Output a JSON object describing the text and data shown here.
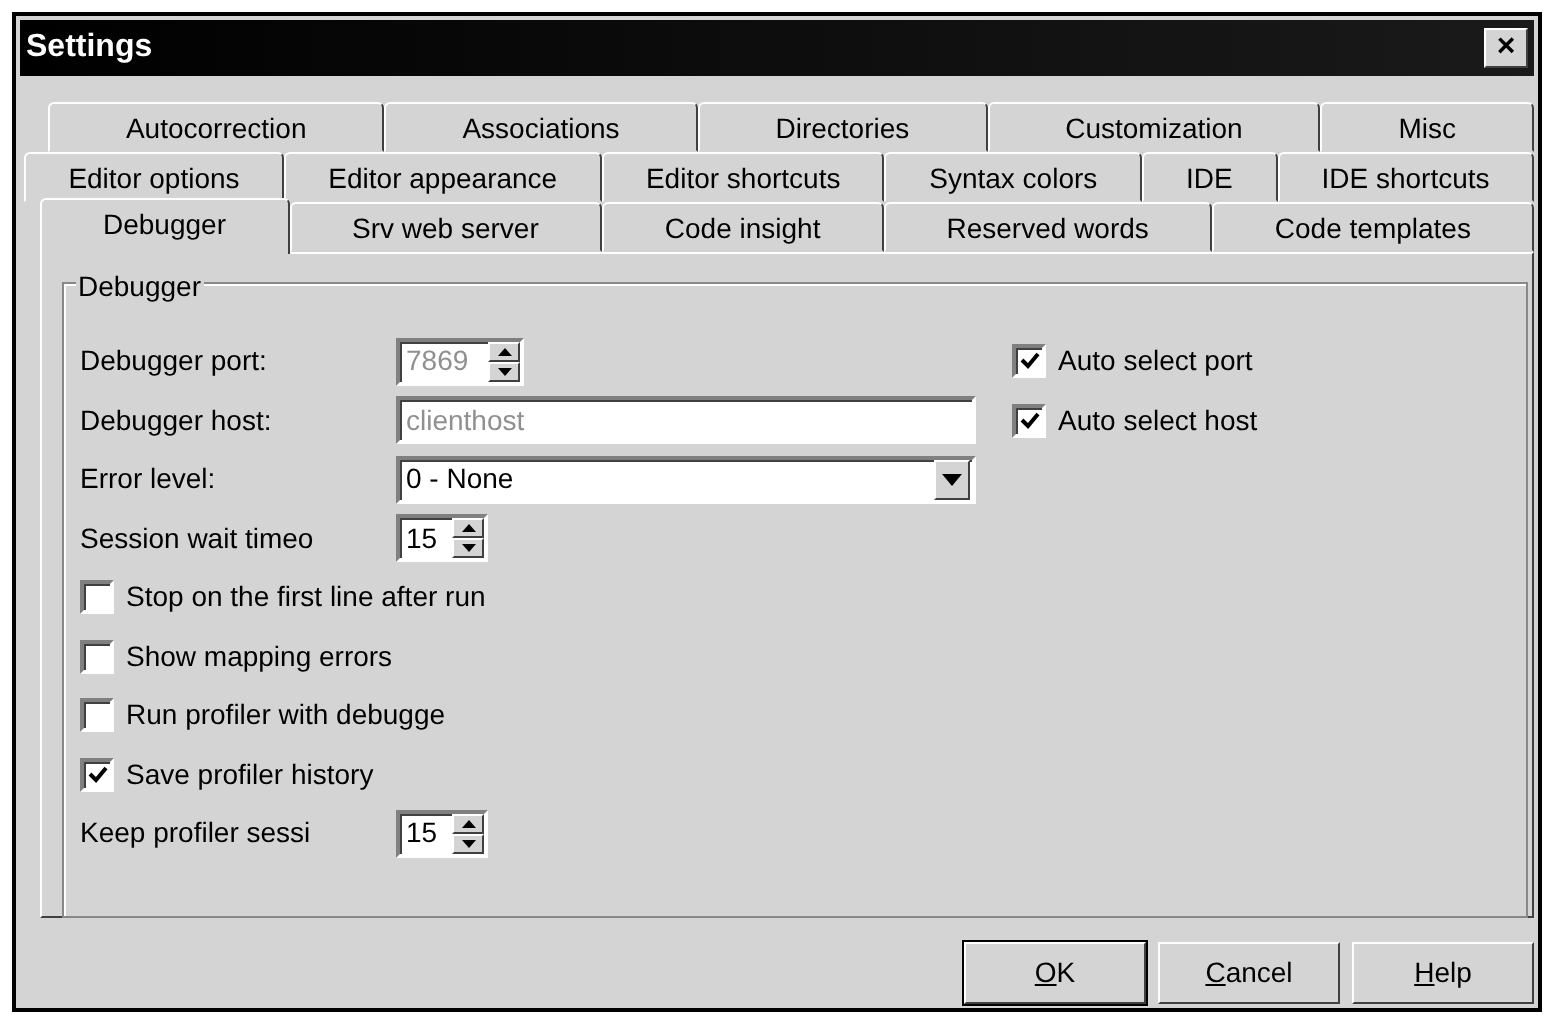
{
  "window": {
    "title": "Settings",
    "close": "×"
  },
  "tab_rows": [
    {
      "tabs": [
        {
          "label": "Autocorrection",
          "selected": false
        },
        {
          "label": "Associations",
          "selected": false
        },
        {
          "label": "Directories",
          "selected": false
        },
        {
          "label": "Customization",
          "selected": false
        },
        {
          "label": "Misc",
          "selected": false
        }
      ]
    },
    {
      "tabs": [
        {
          "label": "Editor options",
          "selected": false
        },
        {
          "label": "Editor appearance",
          "selected": false
        },
        {
          "label": "Editor shortcuts",
          "selected": false
        },
        {
          "label": "Syntax colors",
          "selected": false
        },
        {
          "label": "IDE",
          "selected": false
        },
        {
          "label": "IDE shortcuts",
          "selected": false
        }
      ]
    },
    {
      "tabs": [
        {
          "label": "Debugger",
          "selected": true
        },
        {
          "label": "Srv web server",
          "selected": false
        },
        {
          "label": "Code insight",
          "selected": false
        },
        {
          "label": "Reserved words",
          "selected": false
        },
        {
          "label": "Code templates",
          "selected": false
        }
      ]
    }
  ],
  "group": {
    "title": "Debugger",
    "fields": [
      {
        "kind": "spin",
        "label": "Debugger port:",
        "value": "7869",
        "disabled": true
      },
      {
        "kind": "text",
        "label": "Debugger host:",
        "value": "clienthost",
        "disabled": true
      },
      {
        "kind": "select",
        "label": "Error level:",
        "value": "0 - None",
        "disabled": false
      },
      {
        "kind": "spin",
        "label": "Session wait timeo",
        "value": "15",
        "disabled": false
      },
      {
        "kind": "checkbox",
        "label": "Stop on the first line after run",
        "checked": false
      },
      {
        "kind": "checkbox",
        "label": "Show mapping errors",
        "checked": false
      },
      {
        "kind": "checkbox",
        "label": "Run profiler with debugge",
        "checked": false
      },
      {
        "kind": "checkbox",
        "label": "Save profiler history",
        "checked": true
      },
      {
        "kind": "spin",
        "label": "Keep profiler sessi",
        "value": "15",
        "disabled": false
      }
    ],
    "side_checkboxes": [
      {
        "label": "Auto select port",
        "checked": true
      },
      {
        "label": "Auto select host",
        "checked": true
      }
    ]
  },
  "buttons": [
    {
      "label": "OK",
      "default": true
    },
    {
      "label": "Cancel",
      "default": false
    },
    {
      "label": "Help",
      "default": false
    }
  ]
}
